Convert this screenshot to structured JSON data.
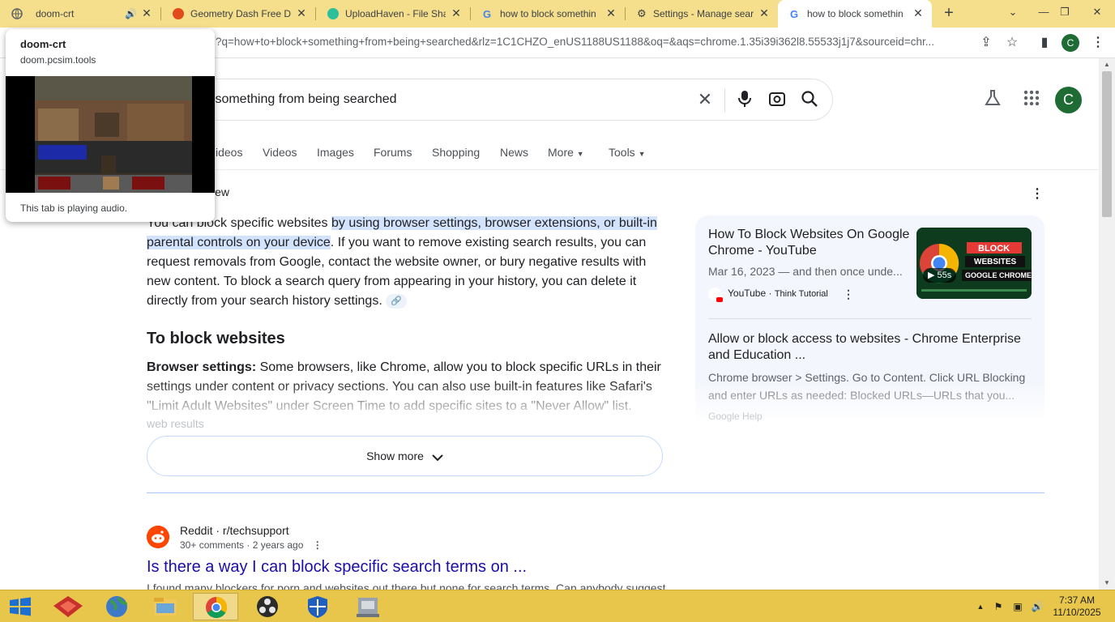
{
  "browser": {
    "tabs": [
      {
        "label": "doom-crt",
        "audio": true
      },
      {
        "label": "Geometry Dash Free Do"
      },
      {
        "label": "UploadHaven - File Sha"
      },
      {
        "label": "how to block somethin"
      },
      {
        "label": "Settings - Manage sear"
      },
      {
        "label": "how to block somethin",
        "active": true
      }
    ],
    "new_tab_symbol": "+",
    "url_visible": "?q=how+to+block+something+from+being+searched&rlz=1C1CHZO_enUS1188US1188&oq=&aqs=chrome.1.35i39i362l8.55533j1j7&sourceid=chr...",
    "profile_initial": "C"
  },
  "hover_card": {
    "title": "doom-crt",
    "domain": "doom.pcsim.tools",
    "status": "This tab is playing audio."
  },
  "google": {
    "query_visible": "k something from being searched",
    "avatar_initial": "C",
    "filters": [
      "ideos",
      "Videos",
      "Images",
      "Forums",
      "Shopping",
      "News",
      "More",
      "Tools"
    ],
    "ai_overview": {
      "label": "iew",
      "p1_pre": "You can block specific websites ",
      "p1_highlight": "by using browser settings, browser extensions, or built-in parental controls on your device",
      "p1_post": ". If you want to remove existing search results, you can request removals from Google, contact the website owner, or bury negative results with new content. To block a search query from appearing in your history, you can delete it directly from your search history settings.",
      "heading": "To block websites",
      "browser_bold": "Browser settings:",
      "browser_text": " Some browsers, like Chrome, allow you to block specific URLs in their settings under content or privacy sections. You can also use built-in features like Safari's \"Limit Adult Websites\" under Screen Time to add specific sites to a \"Never Allow\" list.",
      "faint_line": "web results",
      "show_more": "Show more"
    },
    "side_cards": {
      "video": {
        "title": "How To Block Websites On Google Chrome - YouTube",
        "snippet": "Mar 16, 2023 — and then once unde...",
        "source": "YouTube",
        "channel": "Think Tutorial",
        "duration": "55s",
        "thumb_texts": [
          "BLOCK",
          "WEBSITES",
          "GOOGLE CHROME"
        ]
      },
      "enterprise": {
        "title": "Allow or block access to websites - Chrome Enterprise and Education ...",
        "snippet": "Chrome browser > Settings. Go to Content. Click URL Blocking and enter URLs as needed: Blocked URLs—URLs that you...",
        "faint_source": "Google Help"
      }
    },
    "result": {
      "site": "Reddit · r/techsupport",
      "meta": "30+ comments · 2 years ago",
      "title": "Is there a way I can block specific search terms on ...",
      "snippet": "I found many blockers for porn and websites out there but none for search terms. Can anybody suggest"
    }
  },
  "taskbar": {
    "time": "7:37 AM",
    "date": "11/10/2025"
  },
  "colors": {
    "tabstrip": "#f6df8c",
    "taskbar": "#e8c64b",
    "link": "#1a0dab",
    "highlight": "#d3e3fd",
    "avatar": "#1e6b33"
  }
}
